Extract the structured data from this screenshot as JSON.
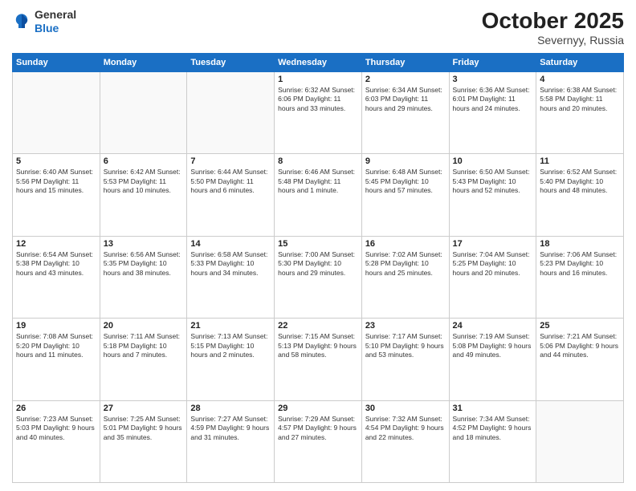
{
  "header": {
    "logo_general": "General",
    "logo_blue": "Blue",
    "month": "October 2025",
    "location": "Severnyy, Russia"
  },
  "days_of_week": [
    "Sunday",
    "Monday",
    "Tuesday",
    "Wednesday",
    "Thursday",
    "Friday",
    "Saturday"
  ],
  "weeks": [
    [
      {
        "day": "",
        "text": ""
      },
      {
        "day": "",
        "text": ""
      },
      {
        "day": "",
        "text": ""
      },
      {
        "day": "1",
        "text": "Sunrise: 6:32 AM\nSunset: 6:06 PM\nDaylight: 11 hours\nand 33 minutes."
      },
      {
        "day": "2",
        "text": "Sunrise: 6:34 AM\nSunset: 6:03 PM\nDaylight: 11 hours\nand 29 minutes."
      },
      {
        "day": "3",
        "text": "Sunrise: 6:36 AM\nSunset: 6:01 PM\nDaylight: 11 hours\nand 24 minutes."
      },
      {
        "day": "4",
        "text": "Sunrise: 6:38 AM\nSunset: 5:58 PM\nDaylight: 11 hours\nand 20 minutes."
      }
    ],
    [
      {
        "day": "5",
        "text": "Sunrise: 6:40 AM\nSunset: 5:56 PM\nDaylight: 11 hours\nand 15 minutes."
      },
      {
        "day": "6",
        "text": "Sunrise: 6:42 AM\nSunset: 5:53 PM\nDaylight: 11 hours\nand 10 minutes."
      },
      {
        "day": "7",
        "text": "Sunrise: 6:44 AM\nSunset: 5:50 PM\nDaylight: 11 hours\nand 6 minutes."
      },
      {
        "day": "8",
        "text": "Sunrise: 6:46 AM\nSunset: 5:48 PM\nDaylight: 11 hours\nand 1 minute."
      },
      {
        "day": "9",
        "text": "Sunrise: 6:48 AM\nSunset: 5:45 PM\nDaylight: 10 hours\nand 57 minutes."
      },
      {
        "day": "10",
        "text": "Sunrise: 6:50 AM\nSunset: 5:43 PM\nDaylight: 10 hours\nand 52 minutes."
      },
      {
        "day": "11",
        "text": "Sunrise: 6:52 AM\nSunset: 5:40 PM\nDaylight: 10 hours\nand 48 minutes."
      }
    ],
    [
      {
        "day": "12",
        "text": "Sunrise: 6:54 AM\nSunset: 5:38 PM\nDaylight: 10 hours\nand 43 minutes."
      },
      {
        "day": "13",
        "text": "Sunrise: 6:56 AM\nSunset: 5:35 PM\nDaylight: 10 hours\nand 38 minutes."
      },
      {
        "day": "14",
        "text": "Sunrise: 6:58 AM\nSunset: 5:33 PM\nDaylight: 10 hours\nand 34 minutes."
      },
      {
        "day": "15",
        "text": "Sunrise: 7:00 AM\nSunset: 5:30 PM\nDaylight: 10 hours\nand 29 minutes."
      },
      {
        "day": "16",
        "text": "Sunrise: 7:02 AM\nSunset: 5:28 PM\nDaylight: 10 hours\nand 25 minutes."
      },
      {
        "day": "17",
        "text": "Sunrise: 7:04 AM\nSunset: 5:25 PM\nDaylight: 10 hours\nand 20 minutes."
      },
      {
        "day": "18",
        "text": "Sunrise: 7:06 AM\nSunset: 5:23 PM\nDaylight: 10 hours\nand 16 minutes."
      }
    ],
    [
      {
        "day": "19",
        "text": "Sunrise: 7:08 AM\nSunset: 5:20 PM\nDaylight: 10 hours\nand 11 minutes."
      },
      {
        "day": "20",
        "text": "Sunrise: 7:11 AM\nSunset: 5:18 PM\nDaylight: 10 hours\nand 7 minutes."
      },
      {
        "day": "21",
        "text": "Sunrise: 7:13 AM\nSunset: 5:15 PM\nDaylight: 10 hours\nand 2 minutes."
      },
      {
        "day": "22",
        "text": "Sunrise: 7:15 AM\nSunset: 5:13 PM\nDaylight: 9 hours\nand 58 minutes."
      },
      {
        "day": "23",
        "text": "Sunrise: 7:17 AM\nSunset: 5:10 PM\nDaylight: 9 hours\nand 53 minutes."
      },
      {
        "day": "24",
        "text": "Sunrise: 7:19 AM\nSunset: 5:08 PM\nDaylight: 9 hours\nand 49 minutes."
      },
      {
        "day": "25",
        "text": "Sunrise: 7:21 AM\nSunset: 5:06 PM\nDaylight: 9 hours\nand 44 minutes."
      }
    ],
    [
      {
        "day": "26",
        "text": "Sunrise: 7:23 AM\nSunset: 5:03 PM\nDaylight: 9 hours\nand 40 minutes."
      },
      {
        "day": "27",
        "text": "Sunrise: 7:25 AM\nSunset: 5:01 PM\nDaylight: 9 hours\nand 35 minutes."
      },
      {
        "day": "28",
        "text": "Sunrise: 7:27 AM\nSunset: 4:59 PM\nDaylight: 9 hours\nand 31 minutes."
      },
      {
        "day": "29",
        "text": "Sunrise: 7:29 AM\nSunset: 4:57 PM\nDaylight: 9 hours\nand 27 minutes."
      },
      {
        "day": "30",
        "text": "Sunrise: 7:32 AM\nSunset: 4:54 PM\nDaylight: 9 hours\nand 22 minutes."
      },
      {
        "day": "31",
        "text": "Sunrise: 7:34 AM\nSunset: 4:52 PM\nDaylight: 9 hours\nand 18 minutes."
      },
      {
        "day": "",
        "text": ""
      }
    ]
  ]
}
